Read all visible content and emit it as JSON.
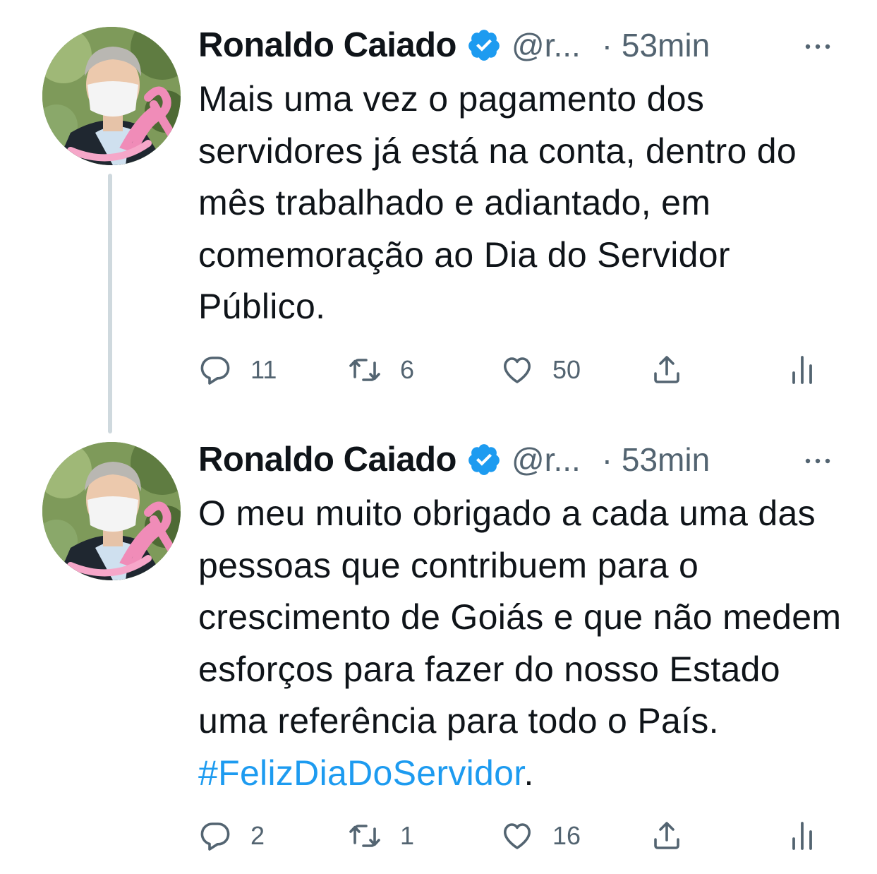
{
  "tweets": [
    {
      "author": {
        "name": "Ronaldo Caiado",
        "handle": "@r...",
        "verified": true,
        "avatar": "avatar-photo-pink-ribbon"
      },
      "time": "· 53min",
      "text": "Mais uma vez o pagamento dos servidores já está na conta, dentro do mês trabalhado e adiantado, em comemoração ao Dia do Servidor Público.",
      "replies": "11",
      "retweets": "6",
      "likes": "50"
    },
    {
      "author": {
        "name": "Ronaldo Caiado",
        "handle": "@r...",
        "verified": true,
        "avatar": "avatar-photo-pink-ribbon"
      },
      "time": "· 53min",
      "text_before": "O meu muito obrigado a cada uma das pessoas que contribuem para o crescimento de Goiás e que não medem esforços para fazer do nosso Estado uma referência para todo o País. ",
      "hashtag": "#FelizDiaDoServidor",
      "text_after": ".",
      "replies": "2",
      "retweets": "1",
      "likes": "16"
    }
  ],
  "icons": {
    "verified": "verified-badge-icon",
    "more": "more-dots-icon",
    "reply": "reply-bubble-icon",
    "retweet": "retweet-icon",
    "like": "heart-icon",
    "share": "share-upload-icon",
    "stats": "analytics-bars-icon"
  },
  "colors": {
    "text": "#0f1419",
    "secondary": "#536471",
    "accent": "#1d9bf0",
    "thread_line": "#cfd9de",
    "ribbon": "#f08cb8"
  }
}
